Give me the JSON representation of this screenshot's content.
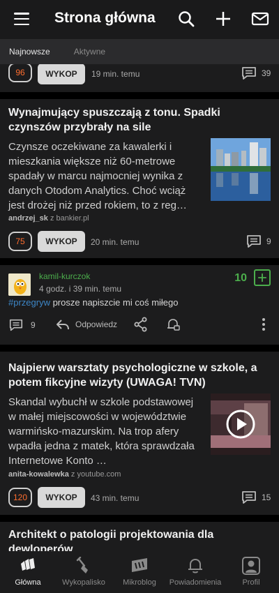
{
  "header": {
    "title": "Strona główna"
  },
  "tabs": [
    {
      "label": "Najnowsze",
      "active": true
    },
    {
      "label": "Aktywne",
      "active": false
    }
  ],
  "feed": {
    "card0": {
      "votes": "96",
      "wykop_label": "WYKOP",
      "time": "19 min. temu",
      "comments": "39"
    },
    "card1": {
      "title": "Wynajmujący spuszczają z tonu. Spadki czynszów przybrały na sile",
      "description": "Czynsze oczekiwane za kawalerki i mieszkania większe niż 60-metrowe spadały w marcu najmocniej wynika z danych Otodom Analytics. Choć wciąż jest drożej niż przed rokiem, to z reg…",
      "author": "andrzej_sk",
      "source": "z bankier.pl",
      "votes": "75",
      "wykop_label": "WYKOP",
      "time": "20 min. temu",
      "comments": "9"
    },
    "microblog": {
      "user": "kamil-kurczok",
      "time": "4 godz. i 39 min. temu",
      "score": "10",
      "tag": "#przegryw",
      "body": " prosze napiszcie mi coś miłego",
      "comments": "9",
      "reply_label": "Odpowiedz"
    },
    "card2": {
      "title": "Najpierw warsztaty psychologiczne w szkole, a potem fikcyjne wizyty (UWAGA! TVN)",
      "description": "Skandal wybuchł w szkole podstawowej w małej miejscowości w województwie warmińsko-mazurskim. Na trop afery wpadła jedna z matek, która sprawdzała Internetowe Konto …",
      "author": "anita-kowalewka",
      "source": "z youtube.com",
      "votes": "120",
      "wykop_label": "WYKOP",
      "time": "43 min. temu",
      "comments": "15"
    },
    "card3": {
      "title": "Architekt o patologii projektowania dla dewloperów"
    }
  },
  "bottom_nav": [
    {
      "label": "Główna",
      "icon": "wykop-logo-icon",
      "active": true
    },
    {
      "label": "Wykopalisko",
      "icon": "shovel-icon",
      "active": false
    },
    {
      "label": "Mikroblog",
      "icon": "mikroblog-icon",
      "active": false
    },
    {
      "label": "Powiadomienia",
      "icon": "bell-icon",
      "active": false
    },
    {
      "label": "Profil",
      "icon": "profile-icon",
      "active": false
    }
  ],
  "colors": {
    "accent_orange": "#ff6d2e",
    "microblog_green": "#4cae4c",
    "tag_blue": "#3d86c6"
  }
}
